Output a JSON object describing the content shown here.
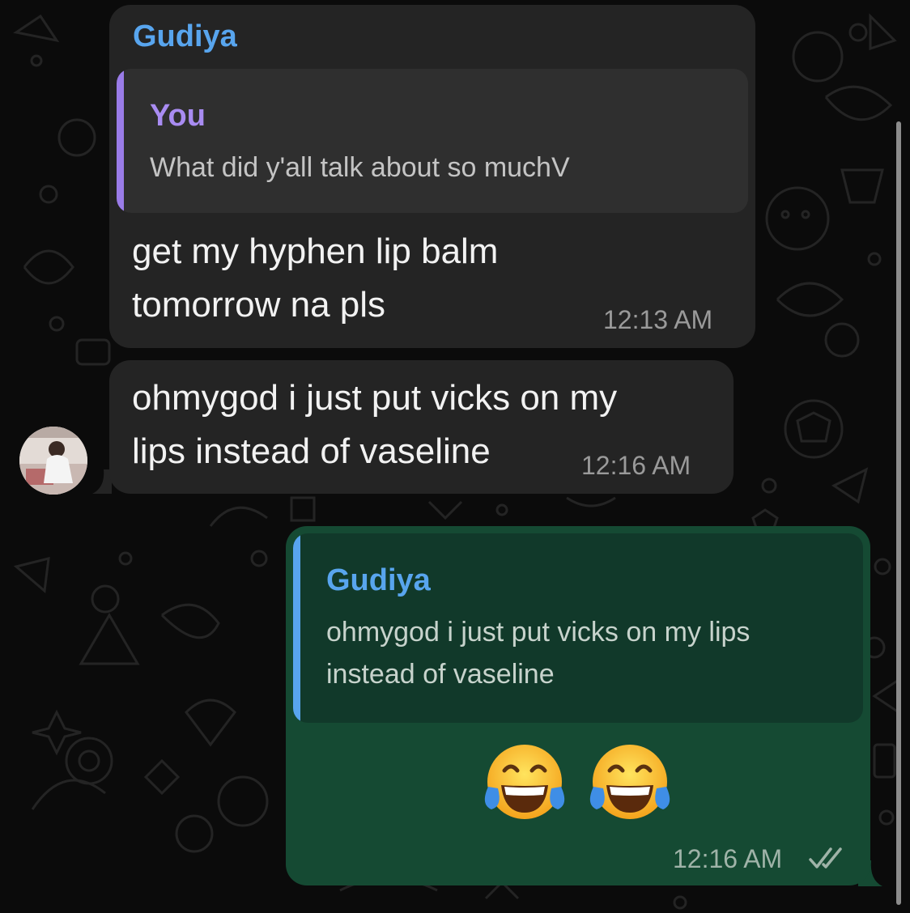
{
  "chat": {
    "bubble1": {
      "sender": "Gudiya",
      "reply_to": {
        "author": "You",
        "text": "What did y'all talk about so muchV"
      },
      "text_line1": "get my hyphen lip balm",
      "text_line2": "tomorrow na pls",
      "time": "12:13 AM"
    },
    "bubble2": {
      "text_line1": "ohmygod i just put vicks on my",
      "text_line2": "lips instead of vaseline",
      "time": "12:16 AM"
    },
    "bubble3": {
      "reply_to": {
        "author": "Gudiya",
        "text_line1": "ohmygod i just put vicks on my lips",
        "text_line2": "instead of vaseline"
      },
      "emoji_names": [
        "tears-of-joy-emoji",
        "tears-of-joy-emoji"
      ],
      "time": "12:16 AM",
      "status_icon": "double-check-icon"
    }
  },
  "colors": {
    "incoming_bubble": "#242424",
    "outgoing_bubble": "#154a33",
    "sender_name": "#58a5ee",
    "reply_you": "#a98cf2",
    "reply_bar_you": "#9a7ce8",
    "reply_bar_gudiya": "#58a5ee"
  }
}
